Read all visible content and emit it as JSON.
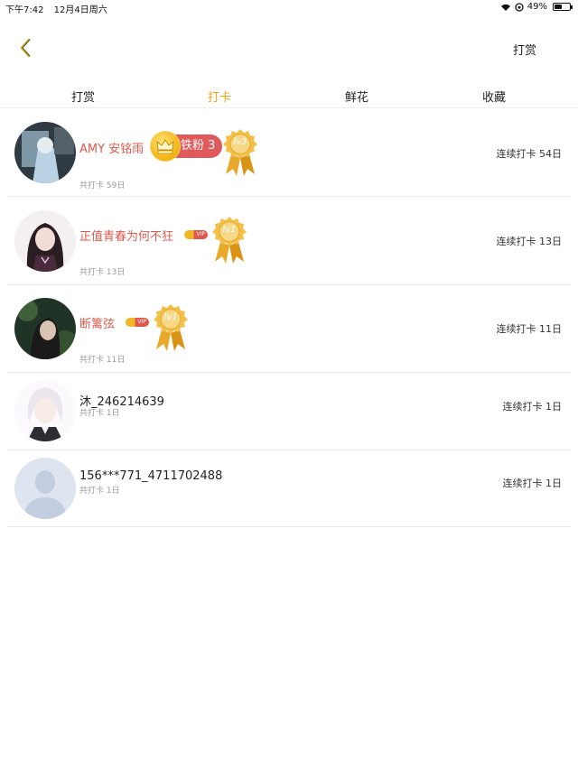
{
  "status_bar": {
    "time": "下午7:42",
    "date": "12月4日周六",
    "battery": "49%",
    "battery_level": 0.49
  },
  "nav": {
    "back_icon": "chevron-left-icon",
    "action_label": "打赏",
    "accent_color": "#e8a316"
  },
  "tabs": [
    {
      "label": "打赏",
      "active": false
    },
    {
      "label": "打卡",
      "active": true
    },
    {
      "label": "鲜花",
      "active": false
    },
    {
      "label": "收藏",
      "active": false
    }
  ],
  "rows": [
    {
      "name": "AMY 安铭雨",
      "total": "共打卡 59日",
      "streak": "连续打卡 54日",
      "fan_badge": "铁粉 3",
      "level": "lv3"
    },
    {
      "name": "正值青春为何不狂",
      "total": "共打卡 13日",
      "streak": "连续打卡 13日",
      "vip": "VIP",
      "level": "lv1"
    },
    {
      "name": "断篱弦",
      "total": "共打卡 11日",
      "streak": "连续打卡 11日",
      "vip": "VIP",
      "level": "lv1"
    },
    {
      "name": "沐_246214639",
      "total": "共打卡 1日",
      "streak": "连续打卡 1日"
    },
    {
      "name": "156***771_4711702488",
      "total": "共打卡 1日",
      "streak": "连续打卡 1日"
    }
  ]
}
